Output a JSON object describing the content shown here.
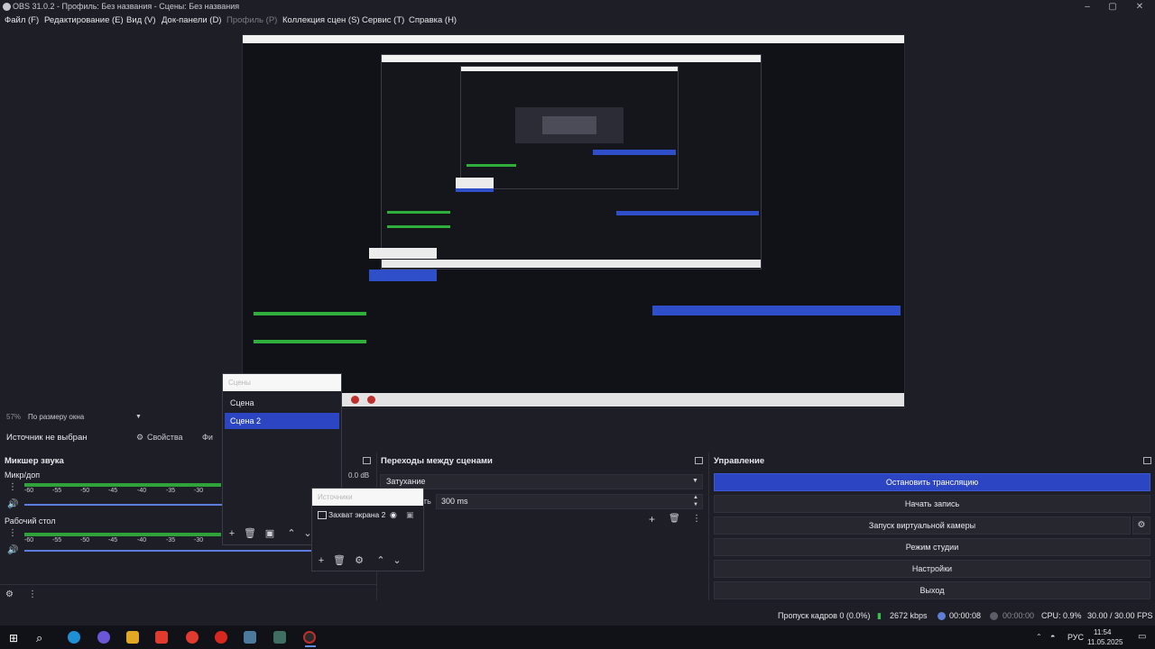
{
  "window": {
    "title": "OBS 31.0.2 - Профиль: Без названия - Сцены: Без названия"
  },
  "menu": [
    {
      "label": "Файл (F)",
      "enabled": true
    },
    {
      "label": "Редактирование (E)",
      "enabled": true
    },
    {
      "label": "Вид (V)",
      "enabled": true
    },
    {
      "label": "Док-панели (D)",
      "enabled": true
    },
    {
      "label": "Профиль (P)",
      "enabled": false
    },
    {
      "label": "Коллекция сцен (S)",
      "enabled": true
    },
    {
      "label": "Сервис (T)",
      "enabled": true
    },
    {
      "label": "Справка (H)",
      "enabled": true
    }
  ],
  "preview": {
    "zoom": "57%",
    "fit_mode": "По размеру окна"
  },
  "source_bar": {
    "no_source": "Источник не выбран",
    "properties": "Свойства",
    "filters": "Фи"
  },
  "scenes": {
    "title": "Сцены",
    "items": [
      {
        "label": "Сцена",
        "selected": false
      },
      {
        "label": "Сцена 2",
        "selected": true
      }
    ]
  },
  "sources": {
    "title": "Источники",
    "items": [
      {
        "label": "Захват экрана 2"
      }
    ]
  },
  "mixer": {
    "title": "Микшер звука",
    "channels": [
      {
        "name": "Микр/доп",
        "db": "0.0 dB"
      },
      {
        "name": "Рабочий стол",
        "db": ""
      }
    ],
    "ticks": [
      "-60",
      "-55",
      "-50",
      "-45",
      "-40",
      "-35",
      "-30"
    ]
  },
  "transitions": {
    "title": "Переходы между сценами",
    "type": "Затухание",
    "duration_label": "ть",
    "duration": "300 ms"
  },
  "controls": {
    "title": "Управление",
    "buttons": [
      {
        "label": "Остановить трансляцию",
        "active": true
      },
      {
        "label": "Начать запись",
        "active": false
      },
      {
        "label": "Запуск виртуальной камеры",
        "active": false
      },
      {
        "label": "Режим студии",
        "active": false
      },
      {
        "label": "Настройки",
        "active": false
      },
      {
        "label": "Выход",
        "active": false
      }
    ]
  },
  "statusbar": {
    "dropped": "Пропуск кадров 0 (0.0%)",
    "bitrate": "2672 kbps",
    "stream_time": "00:00:08",
    "rec_time": "00:00:00",
    "cpu": "CPU: 0.9%",
    "fps": "30.00 / 30.00 FPS"
  },
  "taskbar": {
    "lang": "РУС",
    "time": "11:54",
    "date": "11.05.2025"
  },
  "colors": {
    "accent": "#2c45c2",
    "meter": "#2fa23a",
    "background": "#1e1f26"
  }
}
